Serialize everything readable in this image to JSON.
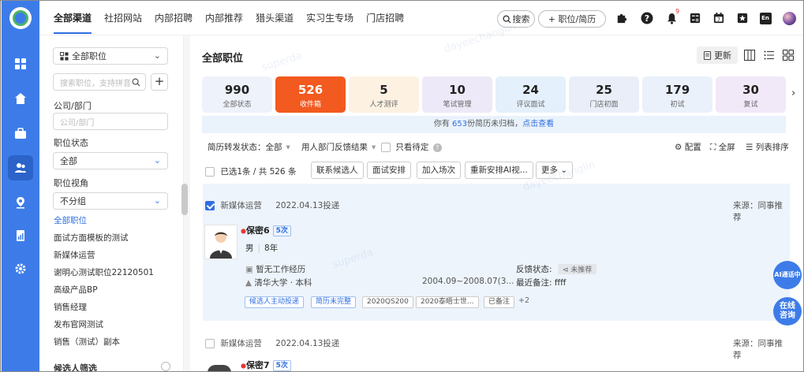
{
  "topbar": {
    "tabs": [
      "全部渠道",
      "社招网站",
      "内部招聘",
      "内部推荐",
      "猎头渠道",
      "实习生专场",
      "门店招聘"
    ],
    "search_label": "搜索",
    "position_resume_label": "+ 职位/简历",
    "notification_count": "9",
    "lang_label": "En"
  },
  "sidebar": {
    "position_dropdown": "全部职位",
    "search_placeholder": "搜索职位，支持拼音",
    "dept_label": "公司/部门",
    "dept_placeholder": "公司/部门",
    "status_label": "职位状态",
    "status_value": "全部",
    "view_label": "职位视角",
    "view_value": "不分组",
    "positions": [
      "全部职位",
      "面试方面模板的测试",
      "新媒体运营",
      "谢明心测试职位22120501",
      "高级产品BP",
      "销售经理",
      "发布官网测试",
      "销售（测试）副本"
    ],
    "bottom_label": "候选人筛选"
  },
  "main": {
    "title": "全部职位",
    "refresh_label": "更新",
    "stats": [
      {
        "n": "990",
        "l": "全部状态"
      },
      {
        "n": "526",
        "l": "收件箱"
      },
      {
        "n": "5",
        "l": "人才测评"
      },
      {
        "n": "10",
        "l": "笔试管理"
      },
      {
        "n": "24",
        "l": "评议面试"
      },
      {
        "n": "25",
        "l": "门店初面"
      },
      {
        "n": "179",
        "l": "初试"
      },
      {
        "n": "30",
        "l": "复试"
      }
    ],
    "notice_prefix": "你有",
    "notice_count": "653",
    "notice_suffix": "份简历未归档，",
    "notice_link": "点击查看",
    "filter_forward": "简历转发状态：全部",
    "filter_feedback": "用人部门反馈结果",
    "filter_pending": "只看待定",
    "config_label": "配置",
    "fullscreen_label": "全屏",
    "sort_label": "列表排序",
    "selected_text": "已选1条 / 共 526 条",
    "actions": [
      "联系候选人",
      "面试安排",
      "加入场次",
      "重新安排AI视...",
      "更多"
    ]
  },
  "card1": {
    "job": "新媒体运营",
    "date": "2022.04.13投递",
    "source": "来源：同事推荐",
    "name": "保密6",
    "times": "5次",
    "gender_age": "男",
    "years": "8年",
    "work": "暂无工作经历",
    "edu": "清华大学 · 本科",
    "edu_period": "2004.09~2008.07(3...",
    "feedback_label": "反馈状态:",
    "feedback_value": "未推荐",
    "note_label": "最近备注:",
    "note_value": "ffff",
    "tags": [
      "候选人主动投递",
      "简历未完整",
      "2020QS200",
      "2020泰晤士世...",
      "已备注",
      "+2"
    ]
  },
  "card2": {
    "job": "新媒体运营",
    "date": "2022.04.13投递",
    "source": "来源：同事推荐",
    "name": "保密7",
    "times": "5次"
  },
  "floats": {
    "ai_call": "AI通话中",
    "online": "在线咨询"
  },
  "colors": {
    "accent": "#3d7ce8",
    "active_stat": "#f25a1f"
  }
}
